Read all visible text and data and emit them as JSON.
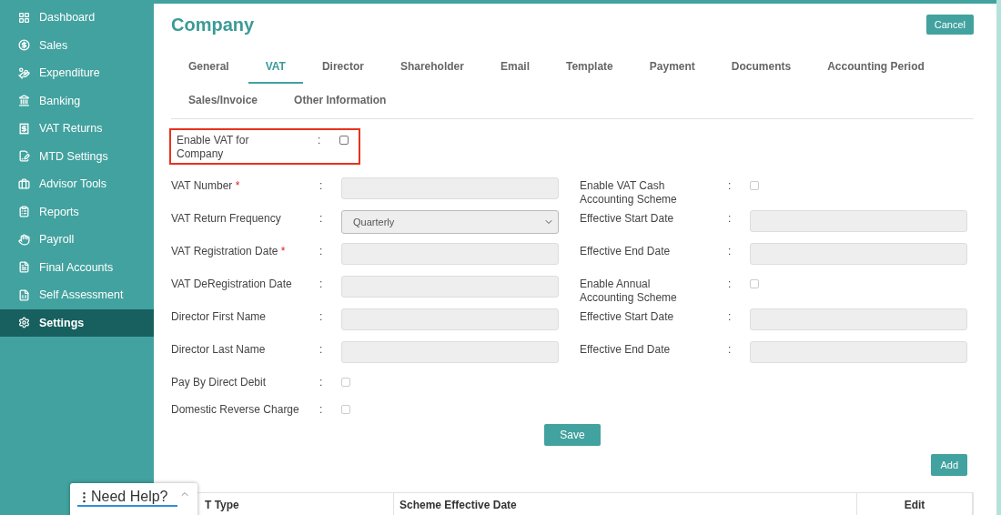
{
  "sidebar": {
    "items": [
      {
        "label": "Dashboard",
        "selected": false
      },
      {
        "label": "Sales",
        "selected": false
      },
      {
        "label": "Expenditure",
        "selected": false
      },
      {
        "label": "Banking",
        "selected": false
      },
      {
        "label": "VAT Returns",
        "selected": false
      },
      {
        "label": "MTD Settings",
        "selected": false
      },
      {
        "label": "Advisor Tools",
        "selected": false
      },
      {
        "label": "Reports",
        "selected": false
      },
      {
        "label": "Payroll",
        "selected": false
      },
      {
        "label": "Final Accounts",
        "selected": false
      },
      {
        "label": "Self Assessment",
        "selected": false
      },
      {
        "label": "Settings",
        "selected": true
      }
    ]
  },
  "page": {
    "title": "Company",
    "cancel_button": "Cancel"
  },
  "tabs": [
    {
      "label": "General",
      "selected": false
    },
    {
      "label": "VAT",
      "selected": true
    },
    {
      "label": "Director",
      "selected": false
    },
    {
      "label": "Shareholder",
      "selected": false
    },
    {
      "label": "Email",
      "selected": false
    },
    {
      "label": "Template",
      "selected": false
    },
    {
      "label": "Payment",
      "selected": false
    },
    {
      "label": "Documents",
      "selected": false
    },
    {
      "label": "Accounting Period",
      "selected": false
    },
    {
      "label": "Sales/Invoice",
      "selected": false
    },
    {
      "label": "Other Information",
      "selected": false
    }
  ],
  "enable_vat": {
    "label": "Enable VAT for Company",
    "separator": ":",
    "checked": false,
    "highlighted": true
  },
  "left_fields": [
    {
      "kind": "input",
      "label": "VAT Number",
      "required_mark": "*",
      "separator": ":"
    },
    {
      "kind": "select",
      "label": "VAT Return Frequency",
      "separator": ":",
      "value": "Quarterly"
    },
    {
      "kind": "input",
      "label": "VAT Registration Date",
      "required_mark": "*",
      "separator": ":"
    },
    {
      "kind": "input",
      "label": "VAT DeRegistration Date",
      "separator": ":"
    },
    {
      "kind": "input",
      "label": "Director First Name",
      "separator": ":"
    },
    {
      "kind": "input",
      "label": "Director Last Name",
      "separator": ":"
    },
    {
      "kind": "checkbox",
      "label": "Pay By Direct Debit",
      "separator": ":",
      "checked": false
    },
    {
      "kind": "checkbox",
      "label": "Domestic Reverse Charge",
      "separator": ":",
      "checked": false
    }
  ],
  "right_fields": [
    {
      "kind": "checkbox",
      "label": "Enable VAT Cash Accounting Scheme",
      "separator": ":",
      "checked": false
    },
    {
      "kind": "input",
      "label": "Effective Start Date",
      "separator": ":"
    },
    {
      "kind": "input",
      "label": "Effective End Date",
      "separator": ":"
    },
    {
      "kind": "checkbox",
      "label": "Enable Annual Accounting Scheme",
      "separator": ":",
      "checked": false
    },
    {
      "kind": "input",
      "label": "Effective Start Date",
      "separator": ":"
    },
    {
      "kind": "input",
      "label": "Effective End Date",
      "separator": ":"
    }
  ],
  "save_button": "Save",
  "add_button": "Add",
  "table": {
    "columns": [
      "T Type",
      "Scheme Effective Date",
      "Edit"
    ]
  },
  "help_widget": {
    "label": "Need Help?"
  }
}
